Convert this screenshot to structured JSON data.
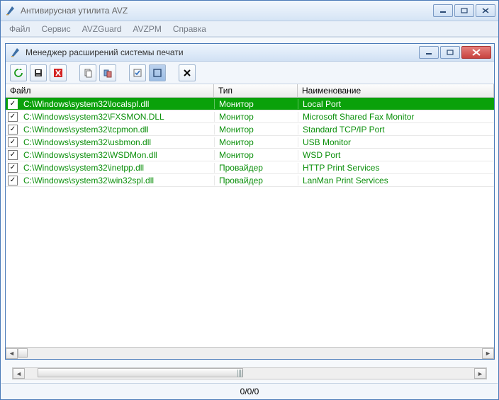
{
  "app": {
    "title": "Антивирусная утилита AVZ",
    "menu": [
      "Файл",
      "Сервис",
      "AVZGuard",
      "AVZPM",
      "Справка"
    ]
  },
  "child": {
    "title": "Менеджер расширений системы печати"
  },
  "columns": {
    "file": "Файл",
    "type": "Тип",
    "name": "Наименование"
  },
  "rows": [
    {
      "checked": true,
      "selected": true,
      "file": "C:\\Windows\\system32\\localspl.dll",
      "type": "Монитор",
      "name": "Local Port"
    },
    {
      "checked": true,
      "selected": false,
      "file": "C:\\Windows\\system32\\FXSMON.DLL",
      "type": "Монитор",
      "name": "Microsoft Shared Fax Monitor"
    },
    {
      "checked": true,
      "selected": false,
      "file": "C:\\Windows\\system32\\tcpmon.dll",
      "type": "Монитор",
      "name": "Standard TCP/IP Port"
    },
    {
      "checked": true,
      "selected": false,
      "file": "C:\\Windows\\system32\\usbmon.dll",
      "type": "Монитор",
      "name": "USB Monitor"
    },
    {
      "checked": true,
      "selected": false,
      "file": "C:\\Windows\\system32\\WSDMon.dll",
      "type": "Монитор",
      "name": "WSD Port"
    },
    {
      "checked": true,
      "selected": false,
      "file": "C:\\Windows\\system32\\inetpp.dll",
      "type": "Провайдер",
      "name": "HTTP Print Services"
    },
    {
      "checked": true,
      "selected": false,
      "file": "C:\\Windows\\system32\\win32spl.dll",
      "type": "Провайдер",
      "name": "LanMan Print Services"
    }
  ],
  "status": "0/0/0"
}
